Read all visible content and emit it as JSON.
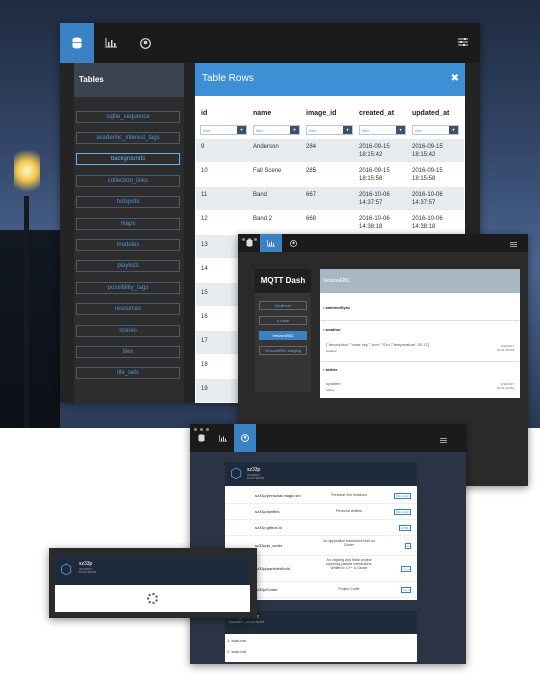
{
  "window_tables": {
    "toolbar_icons": [
      "database-icon",
      "bar-chart-icon",
      "user-circle-icon"
    ],
    "settings_icon": "sliders-icon",
    "sidebar": {
      "title": "Tables",
      "items": [
        "sqlite_sequence",
        "academic_interest_tags",
        "backgrounds",
        "collection_links",
        "hotspots",
        "maps",
        "modules",
        "playlists",
        "possibility_tags",
        "resources",
        "stories",
        "tiles",
        "tile_sets"
      ],
      "selected": "backgrounds"
    },
    "panel": {
      "title": "Table Rows",
      "close": "✖",
      "columns": [
        "id",
        "name",
        "image_id",
        "created_at",
        "updated_at"
      ],
      "filter_placeholder": "filter",
      "rows": [
        {
          "id": "9",
          "name": "Anderson",
          "image_id": "284",
          "created_at": "2016-09-15\n18:15:42",
          "updated_at": "2016-09-15\n18:15:42"
        },
        {
          "id": "10",
          "name": "Fall Scene",
          "image_id": "285",
          "created_at": "2016-09-15\n18:15:58",
          "updated_at": "2016-09-15\n18:15:58"
        },
        {
          "id": "11",
          "name": "Band",
          "image_id": "667",
          "created_at": "2016-10-06\n14:37:57",
          "updated_at": "2016-10-06\n14:37:57"
        },
        {
          "id": "12",
          "name": "Band 2",
          "image_id": "668",
          "created_at": "2016-10-06\n14:38:18",
          "updated_at": "2016-10-06\n14:38:18"
        },
        {
          "id": "13"
        },
        {
          "id": "14"
        },
        {
          "id": "15"
        },
        {
          "id": "16"
        },
        {
          "id": "17"
        },
        {
          "id": "18"
        },
        {
          "id": "19"
        }
      ]
    }
  },
  "window_mqtt": {
    "title": "MQTT Dash",
    "buttons": [
      "localhost",
      "h-base",
      "VerizonEBC",
      "VerizonEBC-staging"
    ],
    "selected": "VerizonEBC",
    "panel_title": "VerizonEBC",
    "sections": [
      {
        "name": "• ambientSync"
      },
      {
        "name": "• weather",
        "payload": "{\"description\":\"clear sky\",\"icon\":\"01n\",\"temperature\":20.37}",
        "topic": "weather",
        "meta": "3/11/2017\n10:41:48 PM"
      },
      {
        "name": "• twitter",
        "payload": "updated",
        "topic": "twitter",
        "meta": "3/11/2017\n10:41:32 PM"
      }
    ]
  },
  "window_github": {
    "user": "sz33p",
    "user_meta": "3/14/2017\n10:47:48 PM",
    "repos": [
      {
        "name": "sz33p/personal-magic.sm",
        "desc": "Personal Vim functions",
        "badge": "Vim script"
      },
      {
        "name": "sz33p/dotfiles",
        "desc": "Personal dotfiles",
        "badge": "Vim script"
      },
      {
        "name": "sz33p.github.io",
        "desc": "",
        "badge": "HTML"
      },
      {
        "name": "sz33p/pi_coder",
        "desc": "An application framework built on Cinder",
        "badge": "C"
      },
      {
        "name": "sz33p/particleWorld",
        "desc": "An ongoing and fickle project exploring particle interactions. Written in C++ & Cinder",
        "badge": "C++"
      },
      {
        "name": "sz33p/Coder",
        "desc": "Project Coder",
        "badge": "C++"
      }
    ],
    "second_panel": {
      "title": "sz33p/master",
      "meta": "3/14/2017 — 10:47:48 PM",
      "lines": [
        "1. todo.md",
        "2. todo.md"
      ]
    }
  },
  "window_loading": {
    "user": "sz33p",
    "meta": "3/14/2017\n10:47:48 PM"
  },
  "colors": {
    "accent": "#3b82c4",
    "panel_head": "#3d8fd6",
    "dark": "#242424"
  }
}
